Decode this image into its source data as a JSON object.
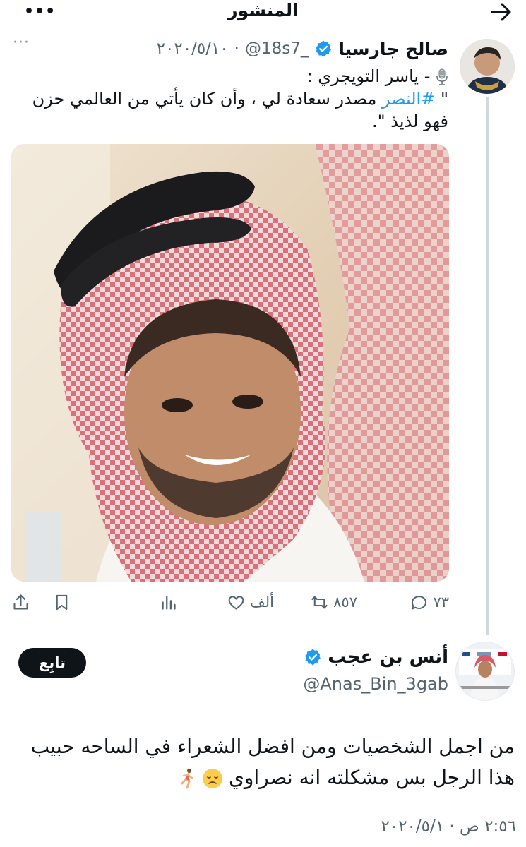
{
  "header": {
    "title": "المنشور",
    "back_icon": "arrow-right-icon",
    "more_icon": "more-horizontal-icon"
  },
  "quoted_tweet": {
    "author_name": "صالح جارسيا",
    "handle": "@18s7_",
    "date": "٢٠٢٠/٥/١٠",
    "separator": "·",
    "text_line1": "- ياسر التويجري :",
    "text_quote_open": "\" ",
    "hashtag": "#النصر",
    "text_rest": " مصدر سعادة لي ، وأن كان يأتي من العالمي حزن فهو لذيذ \".",
    "image_alt": "photo",
    "actions": {
      "replies": "٧٣",
      "retweets": "٨٥٧",
      "likes": "ألف"
    }
  },
  "reply": {
    "author_name": "أنس بن عجب",
    "handle": "@Anas_Bin_3gab",
    "follow_label": "تابِع",
    "text": "من اجمل الشخصيات ومن افضل الشعراء في الساحه حبيب هذا الرجل بس مشكلته انه نصراوي",
    "timestamp": "٢:٥٦ ص · ٢٠٢٠/٥/١"
  },
  "colors": {
    "accent": "#1d9bf0",
    "text": "#0f1419",
    "muted": "#536471",
    "button_bg": "#0f1419"
  }
}
